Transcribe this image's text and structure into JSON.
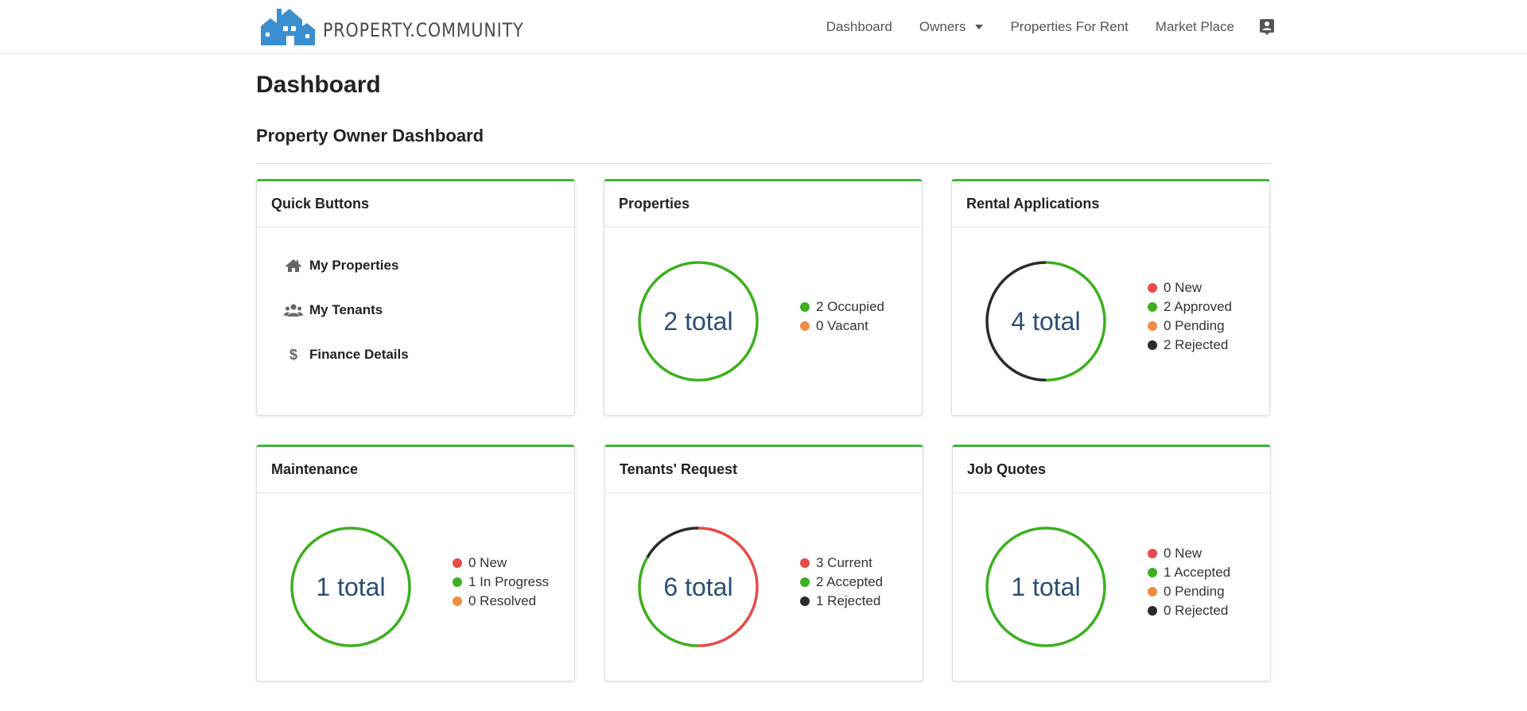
{
  "brand": {
    "name": "PROPERTY.COMMUNITY",
    "color": "#3b8fd0"
  },
  "nav": {
    "items": [
      "Dashboard",
      "Owners",
      "Properties For Rent",
      "Market Place"
    ],
    "owners_has_dropdown": true,
    "user_icon": "contact-card-icon"
  },
  "page": {
    "title": "Dashboard",
    "section_title": "Property Owner Dashboard"
  },
  "colors": {
    "accent_green": "#3cb83c",
    "red": "#e84a4a",
    "green": "#3cb01f",
    "orange": "#f08c45",
    "black": "#2b2b2b"
  },
  "quick_buttons": {
    "title": "Quick Buttons",
    "items": [
      {
        "label": "My Properties",
        "icon": "home-icon"
      },
      {
        "label": "My Tenants",
        "icon": "users-icon"
      },
      {
        "label": "Finance Details",
        "icon": "dollar-icon"
      }
    ]
  },
  "widgets": [
    {
      "title": "Properties",
      "total_label": "2 total",
      "legend": [
        {
          "label": "2 Occupied",
          "value": 2,
          "color": "green"
        },
        {
          "label": "0 Vacant",
          "value": 0,
          "color": "orange"
        }
      ]
    },
    {
      "title": "Rental Applications",
      "total_label": "4 total",
      "legend": [
        {
          "label": "0 New",
          "value": 0,
          "color": "red"
        },
        {
          "label": "2 Approved",
          "value": 2,
          "color": "green"
        },
        {
          "label": "0 Pending",
          "value": 0,
          "color": "orange"
        },
        {
          "label": "2 Rejected",
          "value": 2,
          "color": "black"
        }
      ]
    },
    {
      "title": "Maintenance",
      "total_label": "1 total",
      "legend": [
        {
          "label": "0 New",
          "value": 0,
          "color": "red"
        },
        {
          "label": "1 In Progress",
          "value": 1,
          "color": "green"
        },
        {
          "label": "0 Resolved",
          "value": 0,
          "color": "orange"
        }
      ]
    },
    {
      "title": "Tenants' Request",
      "total_label": "6 total",
      "legend": [
        {
          "label": "3 Current",
          "value": 3,
          "color": "red"
        },
        {
          "label": "2 Accepted",
          "value": 2,
          "color": "green"
        },
        {
          "label": "1 Rejected",
          "value": 1,
          "color": "black"
        }
      ]
    },
    {
      "title": "Job Quotes",
      "total_label": "1 total",
      "legend": [
        {
          "label": "0 New",
          "value": 0,
          "color": "red"
        },
        {
          "label": "1 Accepted",
          "value": 1,
          "color": "green"
        },
        {
          "label": "0 Pending",
          "value": 0,
          "color": "orange"
        },
        {
          "label": "0 Rejected",
          "value": 0,
          "color": "black"
        }
      ]
    }
  ]
}
